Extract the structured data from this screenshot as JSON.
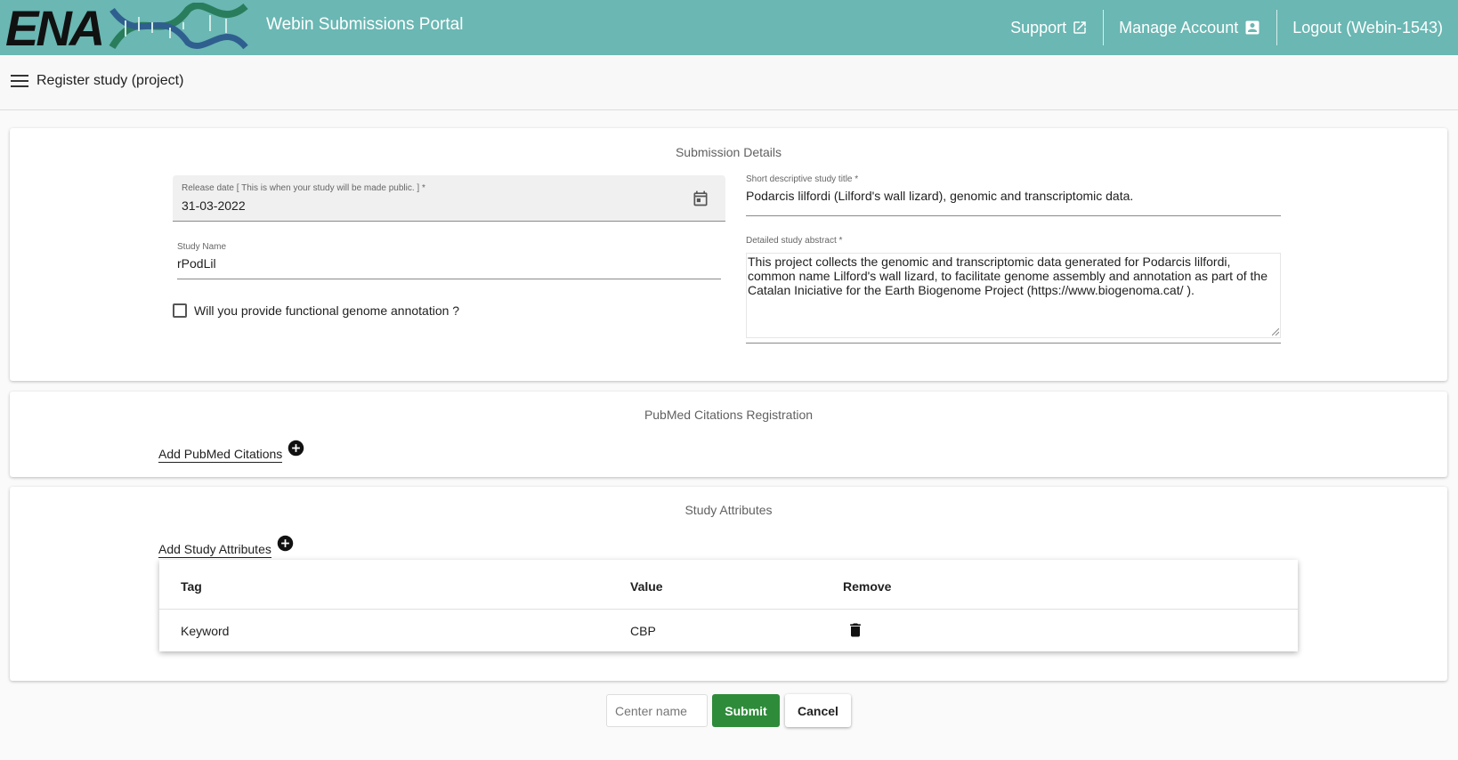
{
  "header": {
    "logo_text": "ENA",
    "portal_title": "Webin Submissions Portal",
    "nav": {
      "support": "Support",
      "manage_account": "Manage Account",
      "logout": "Logout (Webin-1543)"
    },
    "colors": {
      "bar": "#6ab7b3"
    }
  },
  "subheader": {
    "page_title": "Register study (project)"
  },
  "submission_details": {
    "title": "Submission Details",
    "release_date": {
      "label": "Release date [ This is when your study will be made public. ] *",
      "value": "31-03-2022"
    },
    "study_name": {
      "label": "Study Name",
      "value": "rPodLil"
    },
    "functional_annotation": {
      "label": "Will you provide functional genome annotation ?",
      "checked": false
    },
    "study_title": {
      "label": "Short descriptive study title *",
      "value": "Podarcis lilfordi (Lilford's wall lizard), genomic and transcriptomic data."
    },
    "abstract": {
      "label": "Detailed study abstract *",
      "value": "This project collects the genomic and transcriptomic data generated for Podarcis lilfordi, common name Lilford's wall lizard, to facilitate genome assembly and annotation as part of the Catalan Iniciative for the Earth Biogenome Project (https://www.biogenoma.cat/ )."
    }
  },
  "pubmed": {
    "title": "PubMed Citations Registration",
    "add_label": "Add PubMed Citations"
  },
  "attributes": {
    "title": "Study Attributes",
    "add_label": "Add Study Attributes",
    "columns": [
      "Tag",
      "Value",
      "Remove"
    ],
    "rows": [
      {
        "tag": "Keyword",
        "value": "CBP"
      }
    ]
  },
  "actions": {
    "center_name_placeholder": "Center name",
    "submit": "Submit",
    "cancel": "Cancel",
    "submit_color": "#2e8b3a"
  }
}
